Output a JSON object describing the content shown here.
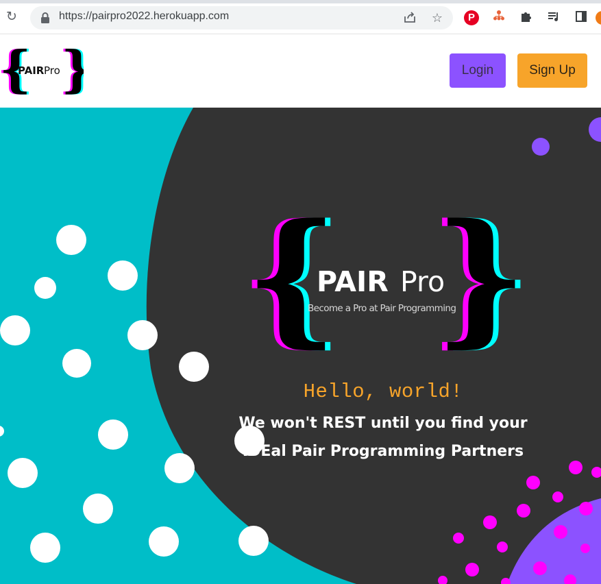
{
  "browser": {
    "url": "https://pairpro2022.herokuapp.com",
    "reload_icon": "reload-icon",
    "lock_icon": "lock-icon",
    "share_icon": "share-icon",
    "bookmark_icon": "star-icon",
    "extensions": [
      "pinterest-icon",
      "org-chart-icon",
      "puzzle-icon",
      "media-queue-icon",
      "side-panel-icon"
    ],
    "pinterest_glyph": "P"
  },
  "navbar": {
    "logo_text_bold": "PAIR",
    "logo_text_light": "Pro",
    "login_label": "Login",
    "signup_label": "Sign Up"
  },
  "hero": {
    "logo_text_bold": "PAIR",
    "logo_text_light": "Pro",
    "logo_subtitle": "Become a Pro at Pair Programming",
    "hello": "Hello, world!",
    "tagline_line1": "We won't REST until you find your",
    "tagline_line2": "IDEal Pair Programming Partners"
  },
  "colors": {
    "teal": "#00bec8",
    "dark": "#333333",
    "purple": "#8c52ff",
    "orange": "#f7a42a",
    "magenta": "#ff00ff",
    "cyan": "#00ffff"
  }
}
